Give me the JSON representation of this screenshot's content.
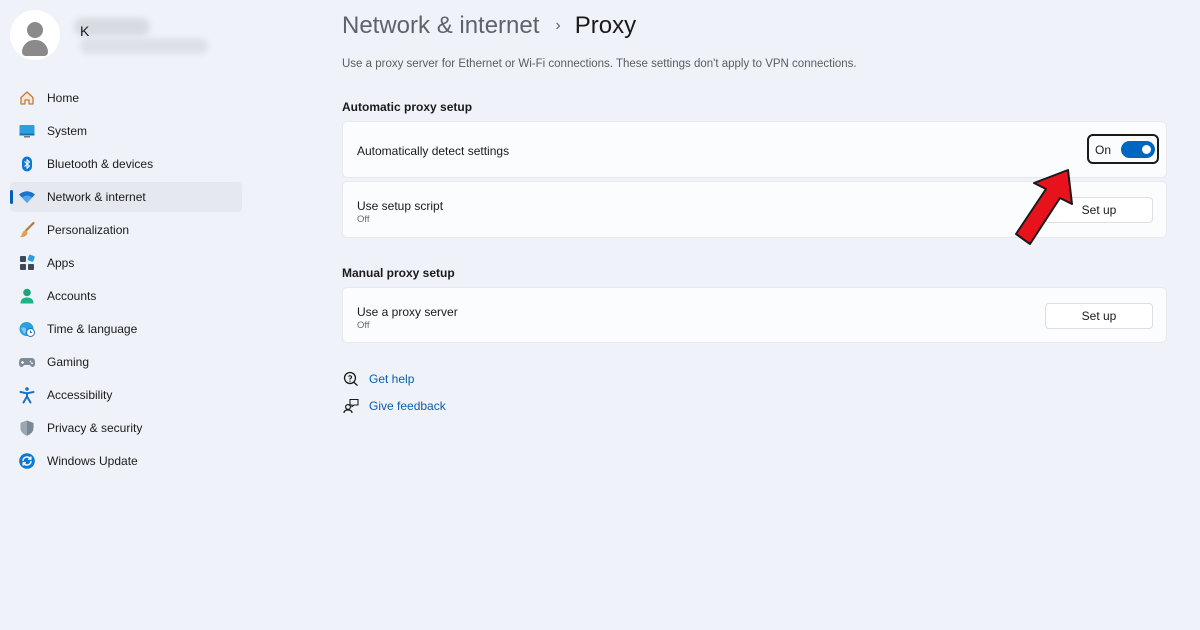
{
  "user": {
    "name": "K"
  },
  "sidebar": {
    "items": [
      {
        "label": "Home",
        "icon": "home-icon"
      },
      {
        "label": "System",
        "icon": "system-icon"
      },
      {
        "label": "Bluetooth & devices",
        "icon": "bluetooth-icon"
      },
      {
        "label": "Network & internet",
        "icon": "wifi-icon",
        "selected": true
      },
      {
        "label": "Personalization",
        "icon": "brush-icon"
      },
      {
        "label": "Apps",
        "icon": "apps-icon"
      },
      {
        "label": "Accounts",
        "icon": "accounts-icon"
      },
      {
        "label": "Time & language",
        "icon": "globe-clock-icon"
      },
      {
        "label": "Gaming",
        "icon": "gamepad-icon"
      },
      {
        "label": "Accessibility",
        "icon": "accessibility-icon"
      },
      {
        "label": "Privacy & security",
        "icon": "shield-icon"
      },
      {
        "label": "Windows Update",
        "icon": "update-icon"
      }
    ]
  },
  "header": {
    "crumb": "Network & internet",
    "separator": "›",
    "current": "Proxy"
  },
  "description": "Use a proxy server for Ethernet or Wi-Fi connections. These settings don't apply to VPN connections.",
  "automatic": {
    "section_title": "Automatic proxy setup",
    "detect": {
      "label": "Automatically detect settings",
      "state": "On"
    },
    "script": {
      "label": "Use setup script",
      "status": "Off",
      "button": "Set up"
    }
  },
  "manual": {
    "section_title": "Manual proxy setup",
    "server": {
      "label": "Use a proxy server",
      "status": "Off",
      "button": "Set up"
    }
  },
  "links": {
    "help": "Get help",
    "feedback": "Give feedback"
  },
  "colors": {
    "accent": "#0067c0",
    "link": "#0b5cad",
    "arrow": "#e8121c",
    "background": "#eff3f9"
  }
}
